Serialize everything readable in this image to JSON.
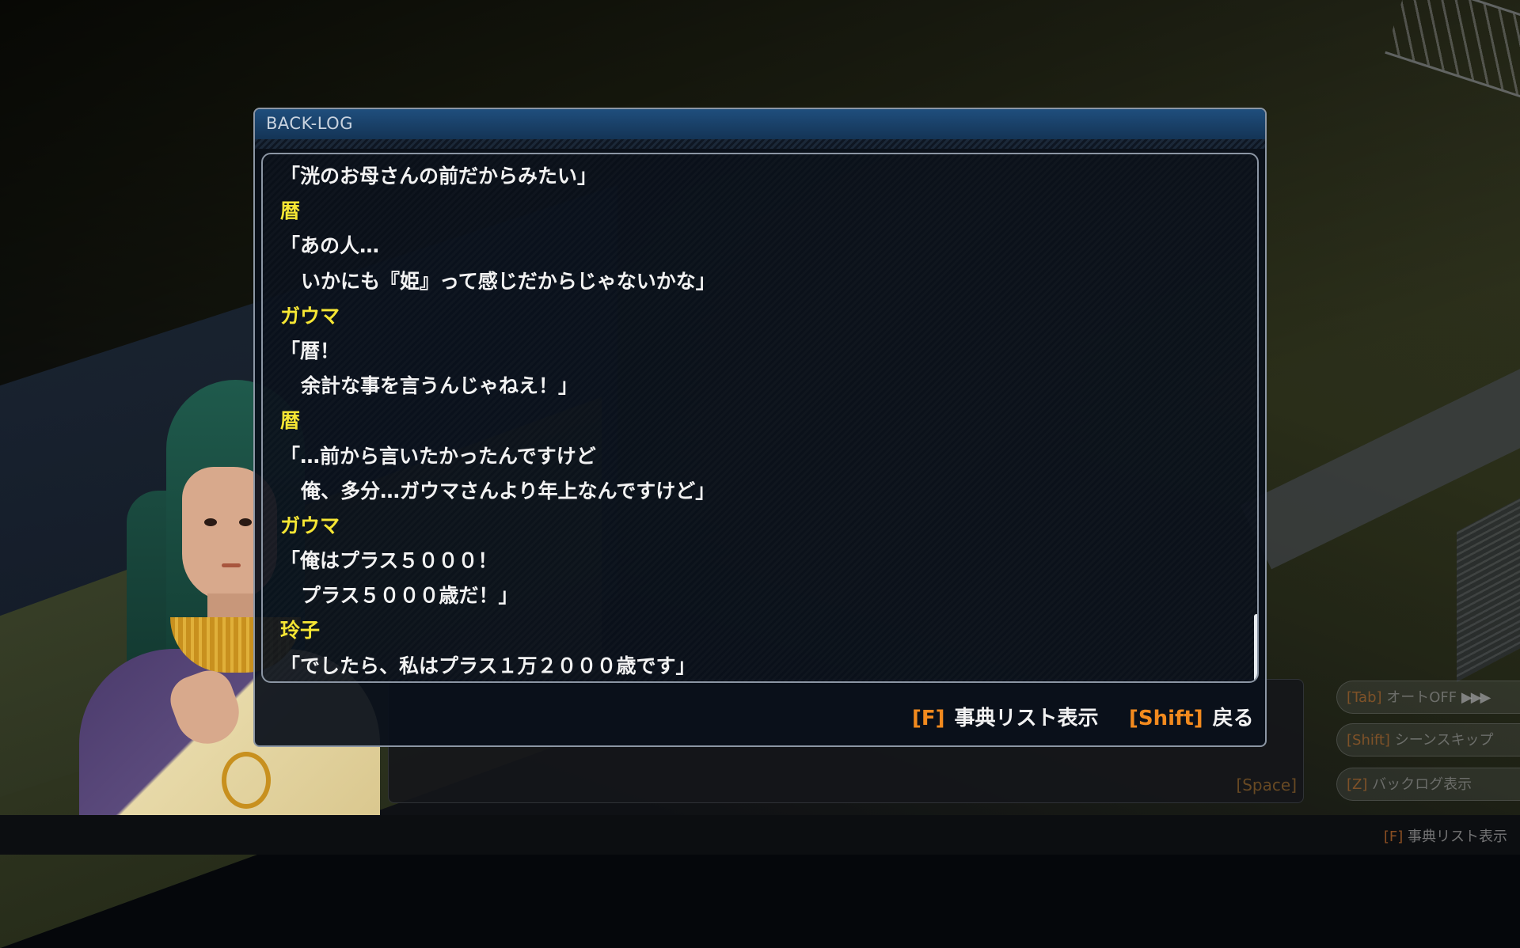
{
  "backlog": {
    "title": "BACK-LOG",
    "lines": [
      {
        "type": "text",
        "text": "「洸のお母さんの前だからみたい」"
      },
      {
        "type": "speaker",
        "text": "暦"
      },
      {
        "type": "text",
        "text": "「あの人…"
      },
      {
        "type": "cont",
        "text": "いかにも『姫』って感じだからじゃないかな」"
      },
      {
        "type": "speaker",
        "text": "ガウマ"
      },
      {
        "type": "text",
        "text": "「暦！"
      },
      {
        "type": "cont",
        "text": "余計な事を言うんじゃねえ！」"
      },
      {
        "type": "speaker",
        "text": "暦"
      },
      {
        "type": "text",
        "text": "「…前から言いたかったんですけど"
      },
      {
        "type": "cont",
        "text": "俺、多分…ガウマさんより年上なんですけど」"
      },
      {
        "type": "speaker",
        "text": "ガウマ"
      },
      {
        "type": "text",
        "text": "「俺はプラス５０００！"
      },
      {
        "type": "cont",
        "text": "プラス５０００歳だ！」"
      },
      {
        "type": "speaker",
        "text": "玲子"
      },
      {
        "type": "text",
        "text": "「でしたら、私はプラス１万２０００歳です」"
      }
    ],
    "footer": {
      "dictionary": {
        "key": "[F]",
        "label": "事典リスト表示"
      },
      "back": {
        "key": "[Shift]",
        "label": "戻る"
      }
    }
  },
  "message_box": {
    "space_hint": "[Space]"
  },
  "side_buttons": [
    {
      "key": "[Tab]",
      "label": "オートOFF",
      "icon": "fast-forward-arrows-icon"
    },
    {
      "key": "[Shift]",
      "label": "シーンスキップ"
    },
    {
      "key": "[Z]",
      "label": "バックログ表示"
    }
  ],
  "bottom_hint": {
    "key": "[F]",
    "label": "事典リスト表示"
  },
  "colors": {
    "speaker": "#f6e634",
    "key_accent": "#f28a1e",
    "header": "#1f4e7d"
  }
}
